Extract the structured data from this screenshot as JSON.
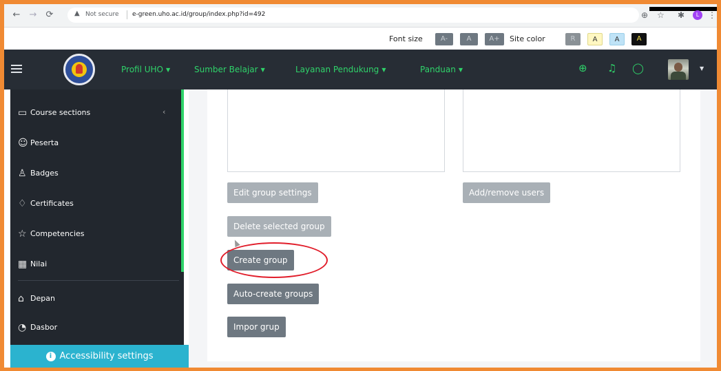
{
  "browser": {
    "security_label": "Not secure",
    "url": "e-green.uho.ac.id/group/index.php?id=492"
  },
  "accessibility_bar": {
    "font_size_label": "Font size",
    "font_buttons": [
      "A-",
      "A",
      "A+"
    ],
    "site_color_label": "Site color",
    "color_buttons": [
      "R",
      "A",
      "A",
      "A"
    ]
  },
  "navbar": {
    "menus": [
      {
        "label": "Profil UHO"
      },
      {
        "label": "Sumber Belajar"
      },
      {
        "label": "Layanan Pendukung"
      },
      {
        "label": "Panduan"
      }
    ],
    "accent_color": "#2fd36a"
  },
  "sidebar": {
    "items": [
      {
        "label": "Course sections",
        "icon": "folder-icon"
      },
      {
        "label": "Peserta",
        "icon": "users-icon"
      },
      {
        "label": "Badges",
        "icon": "badge-icon"
      },
      {
        "label": "Certificates",
        "icon": "certificate-icon"
      },
      {
        "label": "Competencies",
        "icon": "star-icon"
      },
      {
        "label": "Nilai",
        "icon": "gradebook-icon"
      },
      {
        "label": "Depan",
        "icon": "home-icon"
      },
      {
        "label": "Dasbor",
        "icon": "dashboard-icon"
      }
    ],
    "accessibility_settings": "Accessibility settings"
  },
  "main": {
    "buttons": {
      "edit_group_settings": "Edit group settings",
      "add_remove_users": "Add/remove users",
      "delete_selected_group": "Delete selected group",
      "create_group": "Create group",
      "auto_create_groups": "Auto-create groups",
      "impor_grup": "Impor grup"
    },
    "annotation_color": "#e11d2a"
  }
}
